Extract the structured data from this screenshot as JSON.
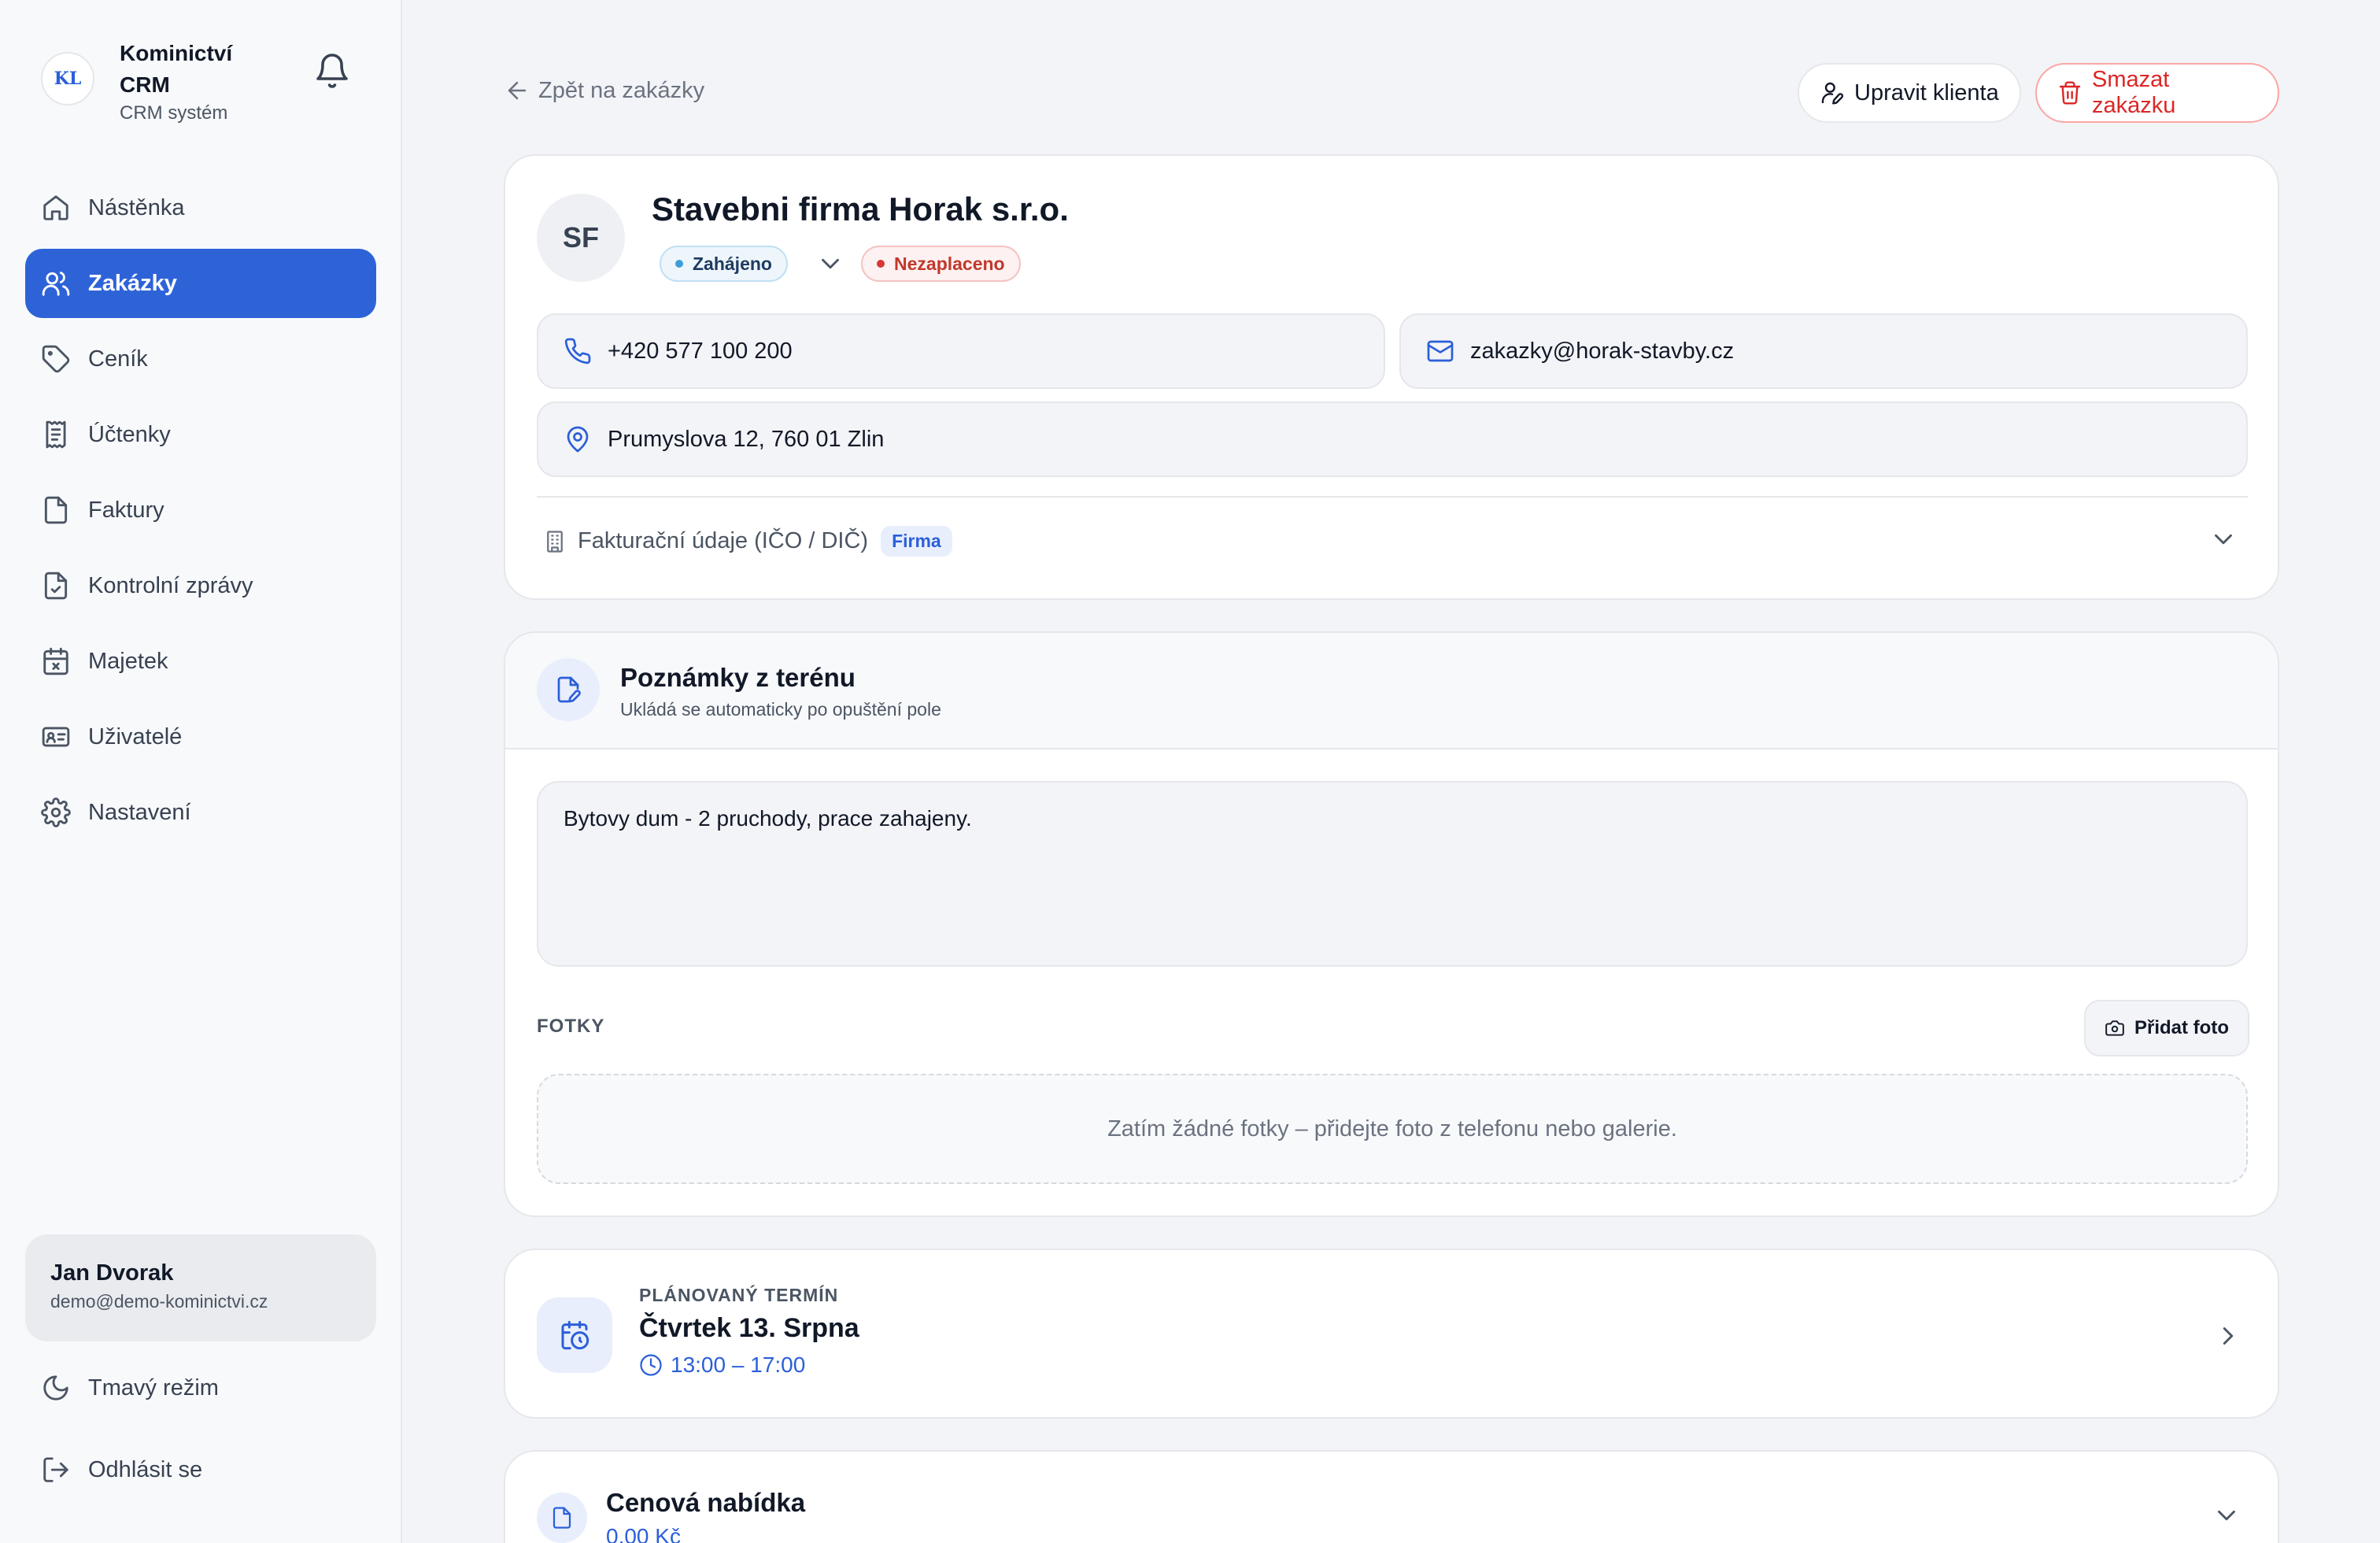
{
  "brand": {
    "logo_text": "KL",
    "name": "Kominictví CRM",
    "subtitle": "CRM systém"
  },
  "sidebar": {
    "items": [
      {
        "label": "Nástěnka",
        "icon": "home-icon",
        "active": false
      },
      {
        "label": "Zakázky",
        "icon": "users-icon",
        "active": true
      },
      {
        "label": "Ceník",
        "icon": "tag-icon",
        "active": false
      },
      {
        "label": "Účtenky",
        "icon": "receipt-icon",
        "active": false
      },
      {
        "label": "Faktury",
        "icon": "file-icon",
        "active": false
      },
      {
        "label": "Kontrolní zprávy",
        "icon": "file-check-icon",
        "active": false
      },
      {
        "label": "Majetek",
        "icon": "calendar-x-icon",
        "active": false
      },
      {
        "label": "Uživatelé",
        "icon": "id-card-icon",
        "active": false
      },
      {
        "label": "Nastavení",
        "icon": "gear-icon",
        "active": false
      }
    ],
    "user": {
      "name": "Jan Dvorak",
      "email": "demo@demo-kominictvi.cz"
    },
    "dark_mode_label": "Tmavý režim",
    "logout_label": "Odhlásit se"
  },
  "header": {
    "back_label": "Zpět na zakázky",
    "edit_client_label": "Upravit klienta",
    "delete_order_label": "Smazat zakázku"
  },
  "client": {
    "initials": "SF",
    "name": "Stavebni firma Horak s.r.o.",
    "status": "Zahájeno",
    "payment_status": "Nezaplaceno",
    "phone": "+420 577 100 200",
    "email": "zakazky@horak-stavby.cz",
    "address": "Prumyslova 12, 760 01 Zlin",
    "billing_label": "Fakturační údaje (IČO / DIČ)",
    "billing_type": "Firma"
  },
  "notes": {
    "title": "Poznámky z terénu",
    "subtitle": "Ukládá se automaticky po opuštění pole",
    "text": "Bytovy dum - 2 pruchody, prace zahajeny.",
    "photos_label": "FOTKY",
    "add_photo_label": "Přidat foto",
    "photos_empty": "Zatím žádné fotky – přidejte foto z telefonu nebo galerie."
  },
  "schedule": {
    "label": "PLÁNOVANÝ TERMÍN",
    "date": "Čtvrtek 13. Srpna",
    "time": "13:00 – 17:00"
  },
  "quote": {
    "title": "Cenová nabídka",
    "value": "0,00 Kč"
  },
  "colors": {
    "accent": "#2e63d8",
    "danger": "#dc2626",
    "status_info": "#3b9ed8"
  }
}
